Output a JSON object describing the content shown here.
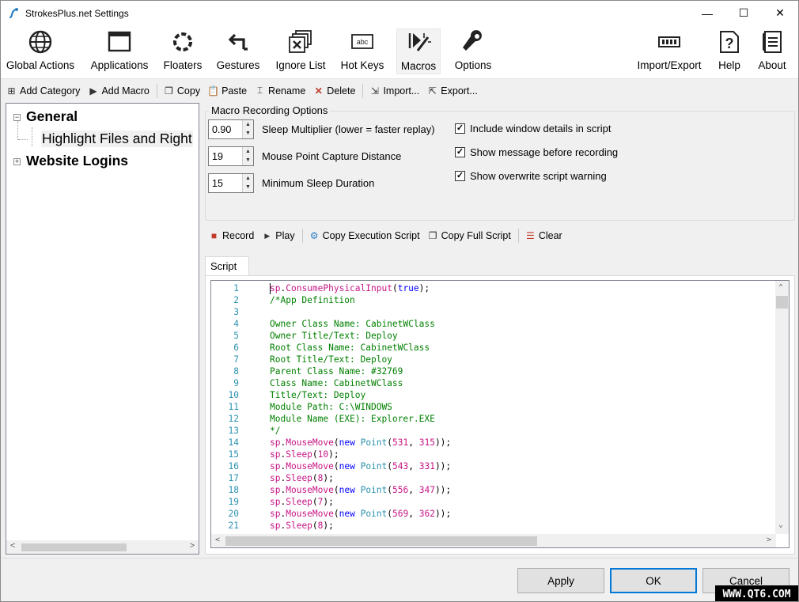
{
  "window": {
    "title": "StrokesPlus.net Settings",
    "minimize": "—",
    "maximize": "☐",
    "close": "✕"
  },
  "ribbon": {
    "tabs": [
      {
        "label": "Global Actions",
        "icon": "globe-icon"
      },
      {
        "label": "Applications",
        "icon": "window-icon"
      },
      {
        "label": "Floaters",
        "icon": "floater-icon"
      },
      {
        "label": "Gestures",
        "icon": "gesture-arrow-icon"
      },
      {
        "label": "Ignore List",
        "icon": "ignore-list-icon"
      },
      {
        "label": "Hot Keys",
        "icon": "keyboard-abc-icon"
      },
      {
        "label": "Macros",
        "icon": "macro-icon",
        "active": true
      },
      {
        "label": "Options",
        "icon": "wrench-icon"
      },
      {
        "label": "Import/Export",
        "icon": "import-export-icon"
      },
      {
        "label": "Help",
        "icon": "help-icon"
      },
      {
        "label": "About",
        "icon": "about-icon"
      }
    ]
  },
  "toolbar": {
    "add_category": "Add Category",
    "add_macro": "Add Macro",
    "copy": "Copy",
    "paste": "Paste",
    "rename": "Rename",
    "delete": "Delete",
    "import": "Import...",
    "export": "Export..."
  },
  "tree": {
    "general": "General",
    "highlight": "Highlight Files and Right",
    "website_logins": "Website Logins",
    "expander_open": "−",
    "expander_closed": "+"
  },
  "options": {
    "group_title": "Macro Recording Options",
    "sleep_multiplier_value": "0.90",
    "sleep_multiplier_label": "Sleep Multiplier (lower = faster replay)",
    "capture_distance_value": "19",
    "capture_distance_label": "Mouse Point Capture Distance",
    "min_sleep_value": "15",
    "min_sleep_label": "Minimum Sleep Duration",
    "include_window_details": "Include window details in script",
    "show_message": "Show message before recording",
    "show_overwrite": "Show overwrite script warning"
  },
  "record_toolbar": {
    "record": "Record",
    "play": "Play",
    "copy_execution": "Copy Execution Script",
    "copy_full": "Copy Full Script",
    "clear": "Clear"
  },
  "script_tab": "Script",
  "script_lines": [
    {
      "n": "1",
      "t": "sp.ConsumePhysicalInput(true);"
    },
    {
      "n": "2",
      "t": "/*App Definition"
    },
    {
      "n": "3",
      "t": ""
    },
    {
      "n": "4",
      "t": "Owner Class Name: CabinetWClass"
    },
    {
      "n": "5",
      "t": "Owner Title/Text: Deploy"
    },
    {
      "n": "6",
      "t": "Root Class Name: CabinetWClass"
    },
    {
      "n": "7",
      "t": "Root Title/Text: Deploy"
    },
    {
      "n": "8",
      "t": "Parent Class Name: #32769"
    },
    {
      "n": "9",
      "t": "Class Name: CabinetWClass"
    },
    {
      "n": "10",
      "t": "Title/Text: Deploy"
    },
    {
      "n": "11",
      "t": "Module Path: C:\\WINDOWS"
    },
    {
      "n": "12",
      "t": "Module Name (EXE): Explorer.EXE"
    },
    {
      "n": "13",
      "t": "*/"
    },
    {
      "n": "14",
      "t": "sp.MouseMove(new Point(531, 315));"
    },
    {
      "n": "15",
      "t": "sp.Sleep(10);"
    },
    {
      "n": "16",
      "t": "sp.MouseMove(new Point(543, 331));"
    },
    {
      "n": "17",
      "t": "sp.Sleep(8);"
    },
    {
      "n": "18",
      "t": "sp.MouseMove(new Point(556, 347));"
    },
    {
      "n": "19",
      "t": "sp.Sleep(7);"
    },
    {
      "n": "20",
      "t": "sp.MouseMove(new Point(569, 362));"
    },
    {
      "n": "21",
      "t": "sp.Sleep(8);"
    }
  ],
  "buttons": {
    "apply": "Apply",
    "ok": "OK",
    "cancel": "Cancel"
  },
  "watermark": "WWW.QT6.COM"
}
